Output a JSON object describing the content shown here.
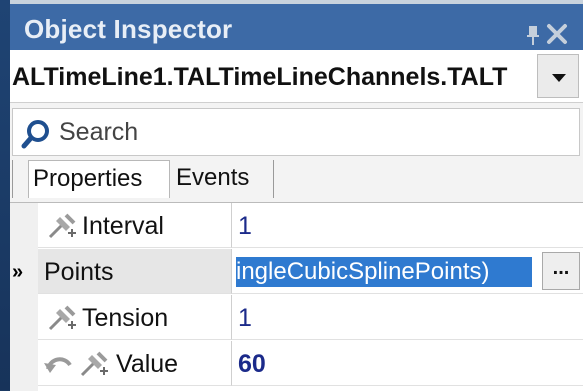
{
  "window": {
    "title": "Object Inspector"
  },
  "selector": {
    "value": "ALTimeLine1.TALTimeLineChannels.TALT"
  },
  "search": {
    "placeholder": "Search"
  },
  "tabs": [
    {
      "label": "Properties",
      "active": true
    },
    {
      "label": "Events",
      "active": false
    }
  ],
  "properties": [
    {
      "name": "Interval",
      "value": "1",
      "icon": "property-pin-icon"
    },
    {
      "name": "Points",
      "value": "ingleCubicSplinePoints)",
      "selected": true,
      "marker": "»",
      "button_label": "..."
    },
    {
      "name": "Tension",
      "value": "1",
      "icon": "property-pin-icon"
    },
    {
      "name": "Value",
      "value": "60",
      "icon": "property-pin-icon",
      "extra_icon": "undo-icon",
      "bold": true
    }
  ],
  "colors": {
    "titlebar": "#3d6aa6",
    "selection": "#2f7ad0",
    "value_text": "#1b2a8a"
  }
}
